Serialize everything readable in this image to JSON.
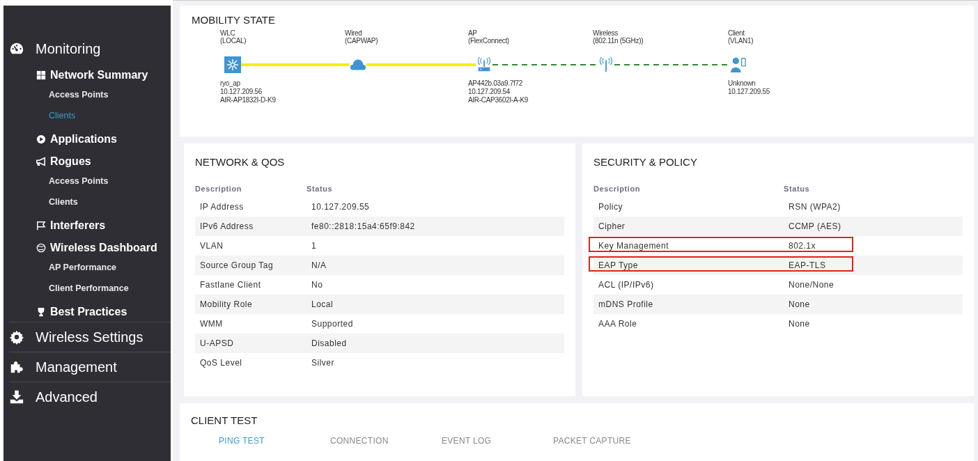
{
  "sidebar": {
    "items": [
      {
        "label": "Monitoring",
        "children": [
          {
            "label": "Network Summary",
            "children": [
              {
                "label": "Access Points",
                "selected": false
              },
              {
                "label": "Clients",
                "selected": true
              }
            ]
          },
          {
            "label": "Applications"
          },
          {
            "label": "Rogues",
            "children": [
              {
                "label": "Access Points",
                "selected": false
              },
              {
                "label": "Clients",
                "selected": false
              }
            ]
          },
          {
            "label": "Interferers"
          },
          {
            "label": "Wireless Dashboard",
            "children": [
              {
                "label": "AP Performance",
                "selected": false
              },
              {
                "label": "Client Performance",
                "selected": false
              }
            ]
          },
          {
            "label": "Best Practices"
          }
        ]
      },
      {
        "label": "Wireless Settings"
      },
      {
        "label": "Management"
      },
      {
        "label": "Advanced"
      }
    ]
  },
  "mobility_state": {
    "title": "MOBILITY STATE",
    "nodes": [
      {
        "kind": "controller",
        "label": [
          "WLC",
          "(LOCAL)"
        ],
        "details": [
          "ryo_ap",
          "10.127.209.56",
          "AIR-AP1832I-D-K9"
        ]
      },
      {
        "kind": "cloud",
        "label": [
          "Wired",
          "(CAPWAP)"
        ]
      },
      {
        "kind": "access-point",
        "label": [
          "AP",
          "(FlexConnect)"
        ],
        "details": [
          "AP442b.03a9.7f72",
          "10.127.209.54",
          "AIR-CAP3602I-A-K9"
        ]
      },
      {
        "kind": "antenna",
        "label": [
          "Wireless",
          "(802.11n (5GHz))"
        ]
      },
      {
        "kind": "client",
        "label": [
          "Client",
          "(VLAN1)"
        ],
        "details": [
          "Unknown",
          "10.127.209.55"
        ]
      }
    ],
    "links": [
      {
        "kind": "wired"
      },
      {
        "kind": "wired"
      },
      {
        "kind": "wireless"
      },
      {
        "kind": "wireless"
      }
    ]
  },
  "network_qos": {
    "title": "NETWORK & QOS",
    "columns": [
      "Description",
      "Status"
    ],
    "rows": [
      {
        "description": "IP Address",
        "status": "10.127.209.55"
      },
      {
        "description": "IPv6 Address",
        "status": "fe80::2818:15a4:65f9:842"
      },
      {
        "description": "VLAN",
        "status": "1"
      },
      {
        "description": "Source Group Tag",
        "status": "N/A"
      },
      {
        "description": "Fastlane Client",
        "status": "No"
      },
      {
        "description": "Mobility Role",
        "status": "Local"
      },
      {
        "description": "WMM",
        "status": "Supported"
      },
      {
        "description": "U-APSD",
        "status": "Disabled"
      },
      {
        "description": "QoS Level",
        "status": "Silver"
      }
    ]
  },
  "security_policy": {
    "title": "SECURITY & POLICY",
    "columns": [
      "Description",
      "Status"
    ],
    "rows": [
      {
        "description": "Policy",
        "status": "RSN (WPA2)",
        "highlighted": false
      },
      {
        "description": "Cipher",
        "status": "CCMP (AES)",
        "highlighted": false
      },
      {
        "description": "Key Management",
        "status": "802.1x",
        "highlighted": true
      },
      {
        "description": "EAP Type",
        "status": "EAP-TLS",
        "highlighted": true
      },
      {
        "description": "ACL (IP/IPv6)",
        "status": "None/None",
        "highlighted": false
      },
      {
        "description": "mDNS Profile",
        "status": "None",
        "highlighted": false
      },
      {
        "description": "AAA Role",
        "status": "None",
        "highlighted": false
      }
    ]
  },
  "client_test": {
    "title": "CLIENT TEST",
    "tabs": [
      {
        "label": "PING TEST",
        "selected": true
      },
      {
        "label": "CONNECTION",
        "selected": false
      },
      {
        "label": "EVENT LOG",
        "selected": false
      },
      {
        "label": "PACKET CAPTURE",
        "selected": false
      }
    ]
  }
}
